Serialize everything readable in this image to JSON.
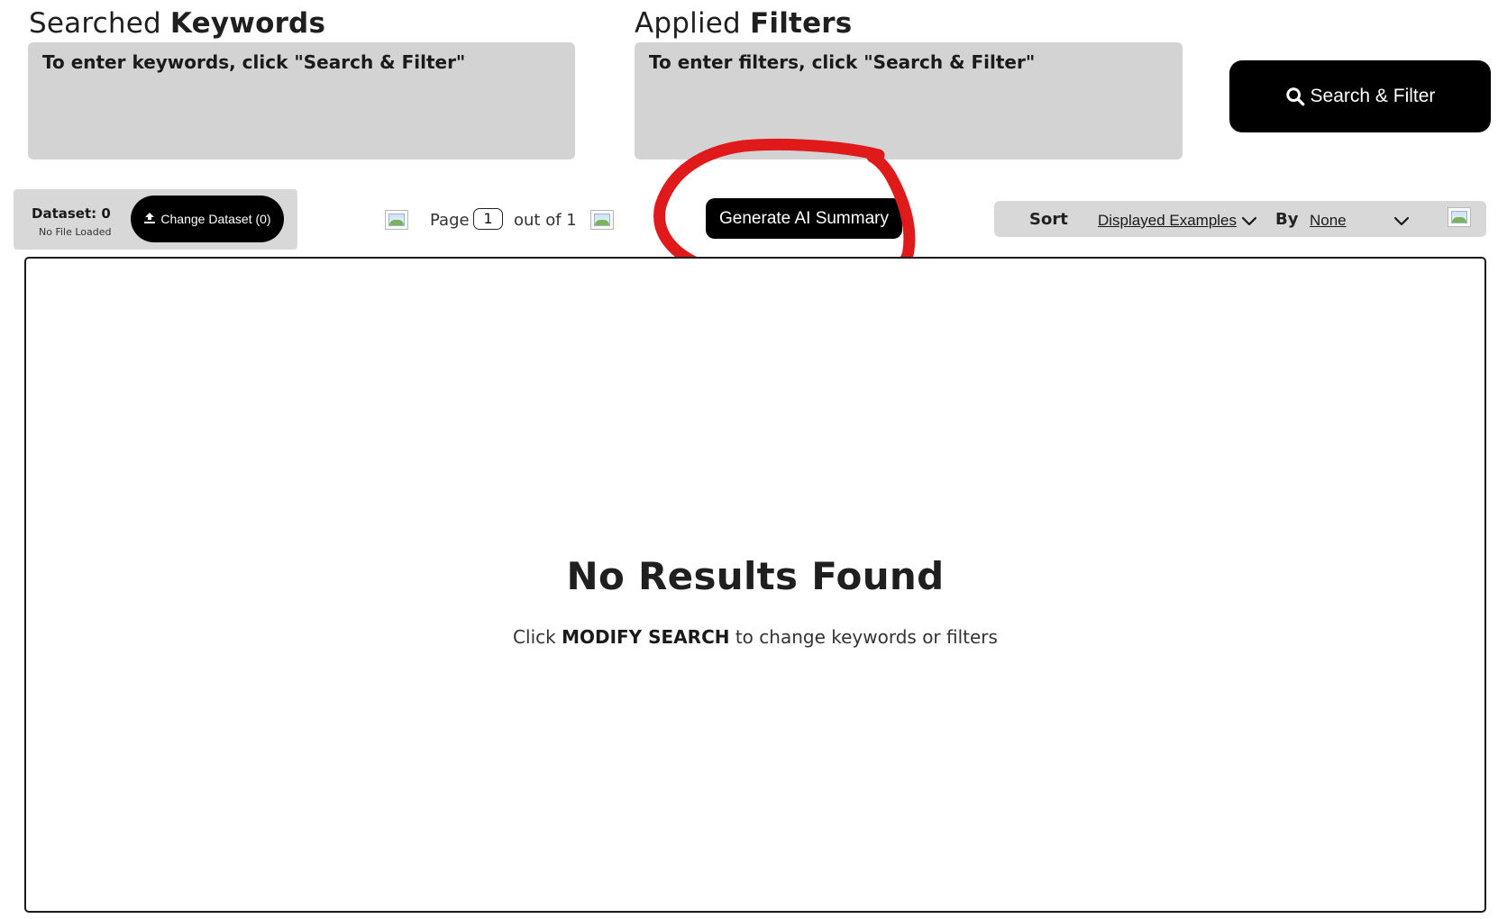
{
  "keywords": {
    "heading_light": "Searched",
    "heading_bold": "Keywords",
    "placeholder": "To enter keywords, click \"Search & Filter\""
  },
  "filters": {
    "heading_light": "Applied",
    "heading_bold": "Filters",
    "placeholder": "To enter filters, click \"Search & Filter\""
  },
  "search_button": {
    "label": "Search & Filter",
    "icon": "search-icon"
  },
  "dataset": {
    "label": "Dataset:",
    "count": "0",
    "status": "No File Loaded",
    "change_button_label": "Change Dataset (0)",
    "change_button_icon": "upload-icon"
  },
  "pagination": {
    "page_label": "Page",
    "current_page": "1",
    "total_label": "out of 1",
    "prev_icon": "broken-image-icon",
    "next_icon": "broken-image-icon"
  },
  "ai_summary_button": {
    "label": "Generate AI Summary"
  },
  "annotation": {
    "color": "#e0191b",
    "shape": "hand-drawn circle around Generate AI Summary button"
  },
  "sort": {
    "label": "Sort",
    "field_value": "Displayed Examples",
    "by_label": "By",
    "by_value": "None",
    "direction_icon": "broken-image-icon"
  },
  "results": {
    "title": "No Results Found",
    "hint_prefix": "Click",
    "hint_bold": "MODIFY SEARCH",
    "hint_suffix": "to change keywords or filters"
  },
  "colors": {
    "panel_grey": "#d3d3d3",
    "button_black": "#000000",
    "text": "#1a1a1a"
  }
}
